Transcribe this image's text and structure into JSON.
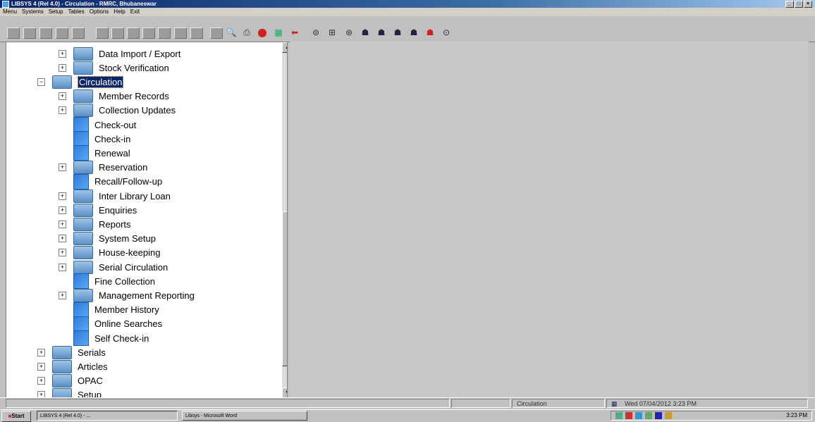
{
  "window": {
    "title": "LIBSYS 4 (Rel 4.0) - Circulation - RMRC, Bhubaneswar"
  },
  "menu": [
    "Menu",
    "Systems",
    "Setup",
    "Tables",
    "Options",
    "Help",
    "Exit"
  ],
  "tree": {
    "items": [
      {
        "label": "Data Import / Export",
        "level": 1,
        "type": "folder",
        "expander": "+"
      },
      {
        "label": "Stock Verification",
        "level": 1,
        "type": "folder",
        "expander": "+"
      },
      {
        "label": "Circulation",
        "level": 0,
        "type": "folder-open",
        "expander": "-",
        "selected": true
      },
      {
        "label": "Member Records",
        "level": 1,
        "type": "folder",
        "expander": "+"
      },
      {
        "label": "Collection Updates",
        "level": 1,
        "type": "folder",
        "expander": "+"
      },
      {
        "label": "Check-out",
        "level": 1,
        "type": "leaf"
      },
      {
        "label": "Check-in",
        "level": 1,
        "type": "leaf"
      },
      {
        "label": "Renewal",
        "level": 1,
        "type": "leaf"
      },
      {
        "label": "Reservation",
        "level": 1,
        "type": "folder",
        "expander": "+"
      },
      {
        "label": "Recall/Follow-up",
        "level": 1,
        "type": "leaf"
      },
      {
        "label": "Inter Library Loan",
        "level": 1,
        "type": "folder",
        "expander": "+"
      },
      {
        "label": "Enquiries",
        "level": 1,
        "type": "folder",
        "expander": "+"
      },
      {
        "label": "Reports",
        "level": 1,
        "type": "folder",
        "expander": "+"
      },
      {
        "label": "System Setup",
        "level": 1,
        "type": "folder",
        "expander": "+"
      },
      {
        "label": "House-keeping",
        "level": 1,
        "type": "folder",
        "expander": "+"
      },
      {
        "label": "Serial Circulation",
        "level": 1,
        "type": "folder",
        "expander": "+"
      },
      {
        "label": "Fine Collection",
        "level": 1,
        "type": "leaf"
      },
      {
        "label": "Management Reporting",
        "level": 1,
        "type": "folder",
        "expander": "+"
      },
      {
        "label": "Member History",
        "level": 1,
        "type": "leaf"
      },
      {
        "label": "Online Searches",
        "level": 1,
        "type": "leaf"
      },
      {
        "label": "Self Check-in",
        "level": 1,
        "type": "leaf"
      },
      {
        "label": "Serials",
        "level": 0,
        "type": "folder",
        "expander": "+"
      },
      {
        "label": "Articles",
        "level": 0,
        "type": "folder",
        "expander": "+"
      },
      {
        "label": "OPAC",
        "level": 0,
        "type": "folder",
        "expander": "+"
      },
      {
        "label": "Setup",
        "level": 0,
        "type": "folder",
        "expander": "+"
      }
    ]
  },
  "status": {
    "module": "Circulation",
    "datetime": "Wed 07/04/2012 3:23 PM"
  },
  "taskbar": {
    "start": "Start",
    "tasks": [
      "LIBSYS 4 (Rel 4.0) - ...",
      "Libsys - Microsoft Word"
    ],
    "clock": "3:23 PM"
  }
}
